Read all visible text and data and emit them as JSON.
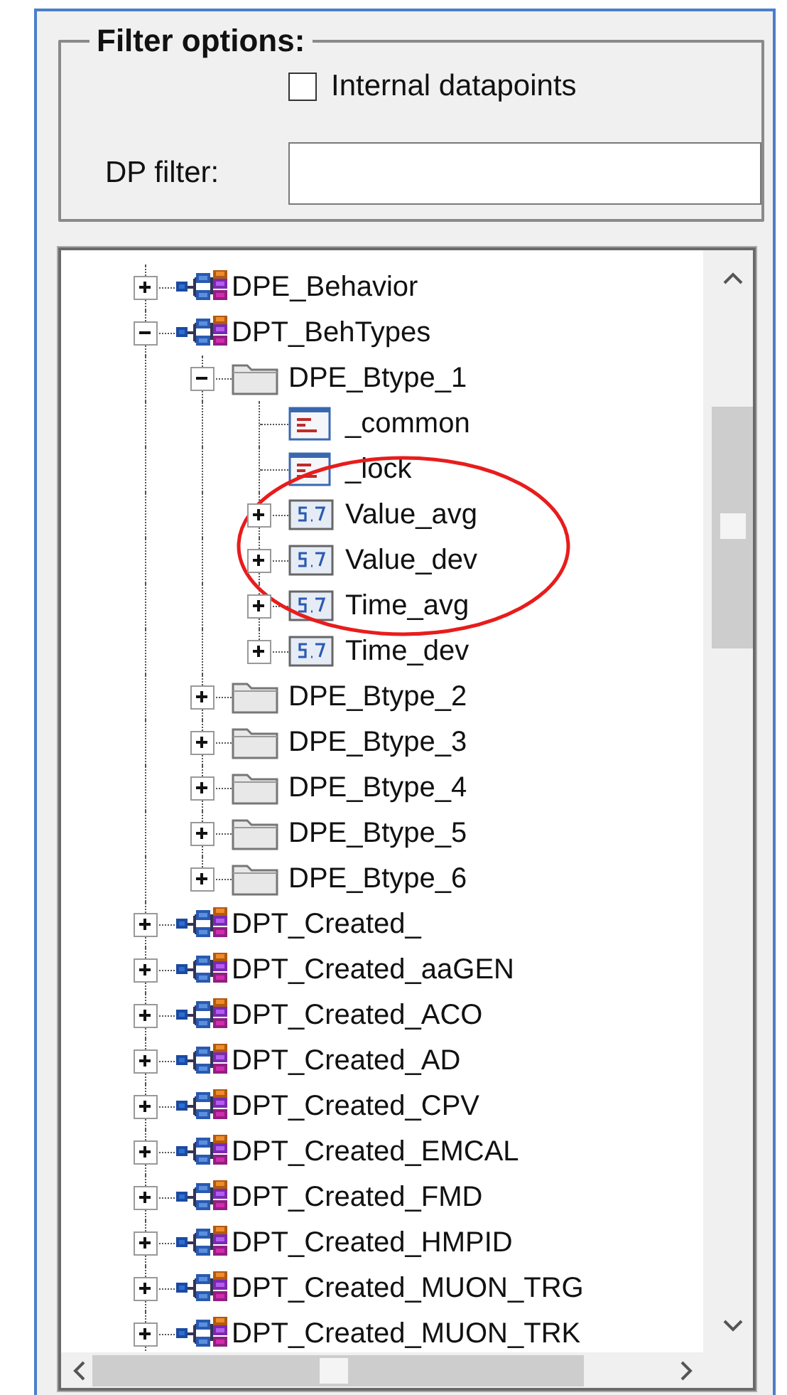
{
  "filter_options": {
    "title": "Filter options:",
    "internal_datapoints": {
      "label": "Internal datapoints",
      "checked": false
    },
    "dp_filter": {
      "label": "DP filter:"
    }
  },
  "tree": {
    "items": [
      {
        "label": "DPE_Behavior",
        "kind": "type",
        "expanded": false
      },
      {
        "label": "DPT_BehTypes",
        "kind": "type",
        "expanded": true,
        "children": [
          {
            "label": "DPE_Btype_1",
            "kind": "folder",
            "expanded": true,
            "children": [
              {
                "label": "_common",
                "kind": "config"
              },
              {
                "label": "_lock",
                "kind": "config"
              },
              {
                "label": "Value_avg",
                "kind": "float",
                "expanded": false
              },
              {
                "label": "Value_dev",
                "kind": "float",
                "expanded": false
              },
              {
                "label": "Time_avg",
                "kind": "float",
                "expanded": false
              },
              {
                "label": "Time_dev",
                "kind": "float",
                "expanded": false
              }
            ]
          },
          {
            "label": "DPE_Btype_2",
            "kind": "folder",
            "expanded": false
          },
          {
            "label": "DPE_Btype_3",
            "kind": "folder",
            "expanded": false
          },
          {
            "label": "DPE_Btype_4",
            "kind": "folder",
            "expanded": false
          },
          {
            "label": "DPE_Btype_5",
            "kind": "folder",
            "expanded": false
          },
          {
            "label": "DPE_Btype_6",
            "kind": "folder",
            "expanded": false
          }
        ]
      },
      {
        "label": "DPT_Created_",
        "kind": "type",
        "expanded": false
      },
      {
        "label": "DPT_Created_aaGEN",
        "kind": "type",
        "expanded": false
      },
      {
        "label": "DPT_Created_ACO",
        "kind": "type",
        "expanded": false
      },
      {
        "label": "DPT_Created_AD",
        "kind": "type",
        "expanded": false
      },
      {
        "label": "DPT_Created_CPV",
        "kind": "type",
        "expanded": false
      },
      {
        "label": "DPT_Created_EMCAL",
        "kind": "type",
        "expanded": false
      },
      {
        "label": "DPT_Created_FMD",
        "kind": "type",
        "expanded": false
      },
      {
        "label": "DPT_Created_HMPID",
        "kind": "type",
        "expanded": false
      },
      {
        "label": "DPT_Created_MUON_TRG",
        "kind": "type",
        "expanded": false
      },
      {
        "label": "DPT_Created_MUON_TRK",
        "kind": "type",
        "expanded": false
      }
    ]
  },
  "annotation": {
    "kind": "ellipse"
  }
}
